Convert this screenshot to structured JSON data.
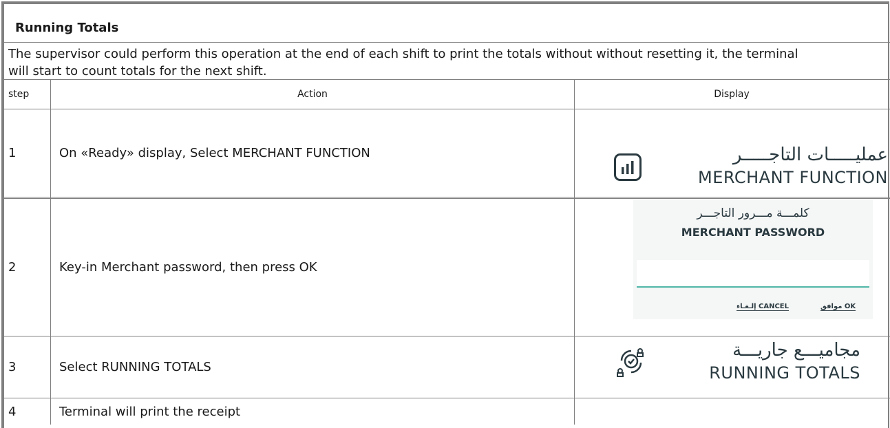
{
  "section_title": "Running Totals",
  "intro": "The supervisor could perform this operation at the end of each shift to print the totals without without resetting it, the terminal will start to count totals for the next shift.",
  "table": {
    "headers": {
      "step": "step",
      "action": "Action",
      "display": "Display"
    },
    "rows": [
      {
        "step": "1",
        "action": "On «Ready» display, Select MERCHANT FUNCTION",
        "display": {
          "arabic": "عمليـــــات التاجـــــر",
          "english": "MERCHANT FUNCTION",
          "icon": "bar-chart-icon"
        }
      },
      {
        "step": "2",
        "action": "Key-in Merchant password, then press OK",
        "display": {
          "arabic": "كلمـــة مـــرور التاجـــر",
          "english": "MERCHANT PASSWORD",
          "ok_label": "موافق OK",
          "cancel_label": "إلـغـاء CANCEL"
        }
      },
      {
        "step": "3",
        "action": "Select RUNNING TOTALS",
        "display": {
          "arabic": "مجاميـــع جاريـــة",
          "english": "RUNNING TOTALS",
          "icon": "running-totals-icon"
        }
      },
      {
        "step": "4",
        "action": "Terminal will print the receipt",
        "display": null
      }
    ]
  },
  "colors": {
    "border": "#808080",
    "icon": "#2a3a40",
    "accent": "#4fb6a8",
    "panel": "#f5f6f6"
  }
}
